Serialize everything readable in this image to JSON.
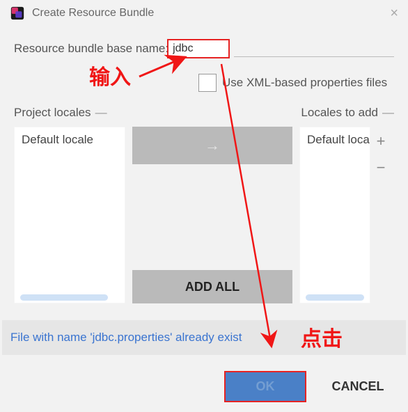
{
  "title": "Create Resource Bundle",
  "field": {
    "label": "Resource bundle base name:",
    "value": "jdbc"
  },
  "xml_checkbox_label": "Use XML-based properties files",
  "left_list": {
    "header": "Project locales",
    "items": [
      "Default locale"
    ]
  },
  "right_list": {
    "header": "Locales to add",
    "items": [
      "Default locale"
    ]
  },
  "buttons": {
    "arrow": "→",
    "add_all": "ADD ALL",
    "plus": "+",
    "minus": "−",
    "ok": "OK",
    "cancel": "CANCEL"
  },
  "warning": "File with name 'jdbc.properties' already exist",
  "annotations": {
    "input_hint": "输入",
    "click_hint": "点击"
  }
}
